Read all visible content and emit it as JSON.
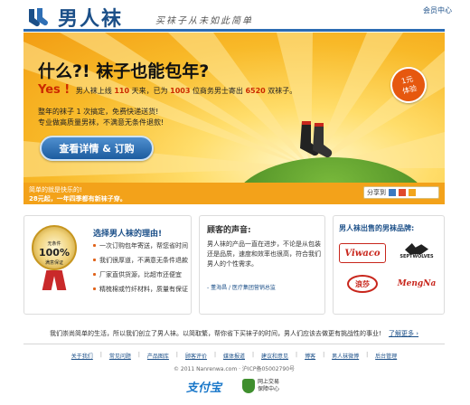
{
  "header": {
    "logo_text": "男人袜",
    "slogan": "买袜子从未如此简单",
    "member_center": "会员中心"
  },
  "hero": {
    "title": "什么?! 袜子也能包年?",
    "yes": "Yes !",
    "line_pre": "男人袜上线",
    "days": "110",
    "line_mid1": "天来，已为",
    "customers": "1003",
    "line_mid2": "位商务男士寄出",
    "pairs": "6520",
    "line_post": "双袜子。",
    "p1": "整年的袜子 1 次搞定，免费快递送货!",
    "p2": "专业做高质量男袜，不满意无条件退款!",
    "button": "查看详情 & 订购",
    "badge_line1": "1元",
    "badge_line2": "体验",
    "bottom_line1": "简单的就是快乐的!",
    "bottom_line2": "28元起，一年四季都有新袜子穿。",
    "share": "分享到"
  },
  "reasons": {
    "title": "选择男人袜的理由!",
    "medal_top": "无条件",
    "medal_pct": "100%",
    "medal_bottom": "满意保证",
    "items": [
      "一次订购包年寄送，帮您省时间",
      "我们很厚道，不满意无条件退款",
      "厂家直供货源，比超市还便宜",
      "精梳棉或竹纤材料，质量有保证"
    ]
  },
  "testimonial": {
    "title": "顾客的声音:",
    "quote": "男人袜的产品一直在进步，不论是从包装还是品质，速度和效率也很高，符合我们男人的个性需求。",
    "cite": "- 董海昌 / 医疗集团营销总监"
  },
  "brands": {
    "title": "男人袜出售的男袜品牌:",
    "b1": "Viwaco",
    "b2": "SEPTWOLVES",
    "b3": "浪莎",
    "b4": "MengNa"
  },
  "footer": {
    "tagline": "我们崇尚简单的生活，所以我们创立了男人袜。以简取繁，帮你省下买袜子的时间，男人们应该去做更有挑战性的事业!",
    "more": "了解更多 ›",
    "nav": [
      "关于我们",
      "常见问题",
      "产品图库",
      "顾客评价",
      "媒体报道",
      "建议和意见",
      "博客",
      "男人袜微博",
      "后台管理"
    ],
    "copyright": "© 2011 Nanrenwa.com · 沪ICP备05002790号",
    "alipay": "支付宝",
    "trust_line1": "网上交易",
    "trust_line2": "保障中心"
  },
  "colors": {
    "brand_blue": "#1b4f88",
    "hero_orange": "#f29d13",
    "badge_orange": "#e6580f",
    "accent_red": "#c8261c"
  }
}
